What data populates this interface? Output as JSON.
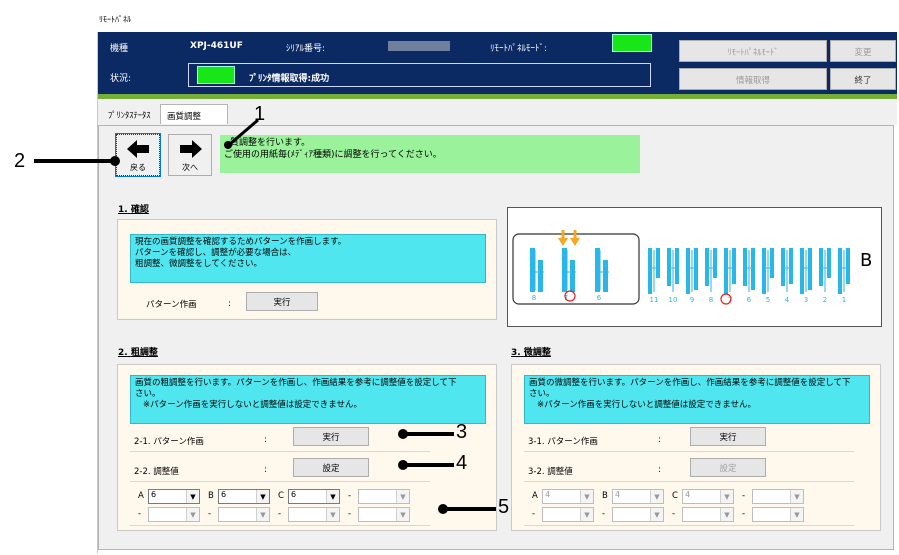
{
  "window": {
    "title": "ﾘﾓｰﾄﾊﾟﾈﾙ"
  },
  "header": {
    "model_label": "機種",
    "model_value": "XPJ-461UF",
    "serial_label": "ｼﾘｱﾙ番号:",
    "remote_mode_label": "ﾘﾓｰﾄﾊﾟﾈﾙﾓｰﾄﾞ:",
    "status_label": "状況:",
    "status_value": "ﾌﾟﾘﾝﾀ情報取得:成功",
    "indicator_color": "#17e617",
    "buttons": {
      "remote_mode": "ﾘﾓｰﾄﾊﾟﾈﾙﾓｰﾄﾞ",
      "change": "変更",
      "get_info": "情報取得",
      "exit": "終了"
    }
  },
  "tabs": [
    {
      "label": "ﾌﾟﾘﾝﾀｽﾃｰﾀｽ",
      "active": false
    },
    {
      "label": "画質調整",
      "active": true
    }
  ],
  "nav": {
    "back_label": "戻る",
    "next_label": "次へ",
    "message_line1": "質調整を行います。",
    "message_line2": "ご使用の用紙毎(ﾒﾃﾞｨｱ種類)に調整を行ってください。"
  },
  "section1": {
    "num": "1.",
    "title": "確認",
    "desc_line1": "現在の画質調整を確認するためパターンを作画します。",
    "desc_line2": "パターンを確認し、調整が必要な場合は、",
    "desc_line3": "粗調整、微調整をしてください。",
    "pattern_label": "パターン作画",
    "colon": ":",
    "run_button": "実行"
  },
  "section2": {
    "num": "2.",
    "title": "粗調整",
    "desc_line1": "画質の粗調整を行います。パターンを作画し、作画結果を参考に調整値を設定して下",
    "desc_line2": "さい。",
    "desc_line3": "※パターン作画を実行しないと調整値は設定できません。",
    "step1_label": "2-1.  パターン作画",
    "step2_label": "2-2.  調整値",
    "colon": ":",
    "run_button": "実行",
    "set_button": "設定",
    "selects": [
      {
        "label": "A",
        "value": "6"
      },
      {
        "label": "B",
        "value": "6"
      },
      {
        "label": "C",
        "value": "6"
      },
      {
        "label": "-",
        "value": ""
      },
      {
        "label": "-",
        "value": ""
      },
      {
        "label": "-",
        "value": ""
      },
      {
        "label": "-",
        "value": ""
      },
      {
        "label": "-",
        "value": ""
      }
    ]
  },
  "section3": {
    "num": "3.",
    "title": "微調整",
    "desc_line1": "画質の微調整を行います。パターンを作画し、作画結果を参考に調整値を設定して下",
    "desc_line2": "さい。",
    "desc_line3": "※パターン作画を実行しないと調整値は設定できません。",
    "step1_label": "3-1.  パターン作画",
    "step2_label": "3-2.  調整値",
    "colon": ":",
    "run_button": "実行",
    "set_button": "設定",
    "selects": [
      {
        "label": "A",
        "value": "4"
      },
      {
        "label": "B",
        "value": "4"
      },
      {
        "label": "C",
        "value": "4"
      },
      {
        "label": "-",
        "value": ""
      },
      {
        "label": "-",
        "value": ""
      },
      {
        "label": "-",
        "value": ""
      },
      {
        "label": "-",
        "value": ""
      },
      {
        "label": "-",
        "value": ""
      }
    ]
  },
  "diagram": {
    "left_numbers": [
      "8",
      "7",
      "6"
    ],
    "right_numbers": [
      "11",
      "10",
      "9",
      "8",
      "7",
      "6",
      "5",
      "4",
      "3",
      "2",
      "1"
    ],
    "label_B": "B",
    "bar_color": "#29b6e8",
    "arrow_color": "#f5a623",
    "circle_color": "#e02020"
  },
  "callouts": {
    "c1": "1",
    "c2": "2",
    "c3": "3",
    "c4": "4",
    "c5": "5"
  }
}
